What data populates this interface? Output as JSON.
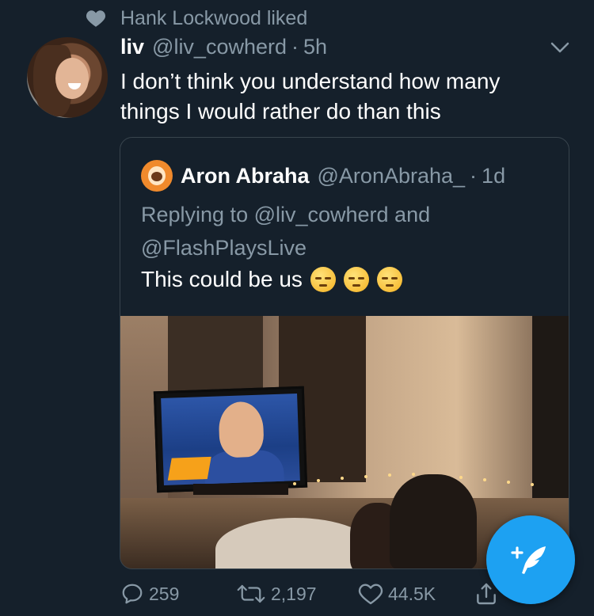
{
  "social_context": {
    "icon": "heart-icon",
    "text": "Hank Lockwood liked"
  },
  "tweet": {
    "author_name": "liv",
    "author_handle": "@liv_cowherd",
    "separator": "·",
    "time": "5h",
    "text": "I don’t think you understand how many things I would rather do than this"
  },
  "quoted_tweet": {
    "author_name": "Aron Abraha",
    "author_handle": "@AronAbraha_",
    "separator": "·",
    "time": "1d",
    "replying_to": "Replying to @liv_cowherd and @FlashPlaysLive",
    "text": "This could be us",
    "emojis": [
      "pensive-face-emoji",
      "pensive-face-emoji",
      "pensive-face-emoji"
    ]
  },
  "actions": {
    "reply_count": "259",
    "retweet_count": "2,197",
    "like_count": "44.5K"
  },
  "colors": {
    "background": "#15202b",
    "secondary_text": "#8899a6",
    "border": "#38444d",
    "accent": "#1da1f2"
  }
}
